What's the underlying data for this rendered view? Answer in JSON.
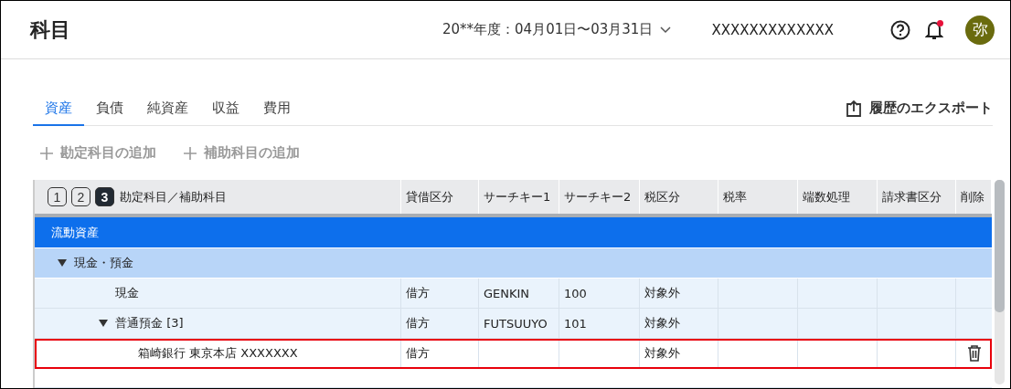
{
  "header": {
    "title": "科目",
    "period": "20**年度：04月01日〜03月31日",
    "company": "XXXXXXXXXXXXX",
    "avatar": "弥",
    "notification": true
  },
  "tabs": [
    {
      "label": "資産",
      "selected": true
    },
    {
      "label": "負債",
      "selected": false
    },
    {
      "label": "純資産",
      "selected": false
    },
    {
      "label": "収益",
      "selected": false
    },
    {
      "label": "費用",
      "selected": false
    }
  ],
  "export_button": "履歴のエクスポート",
  "actions": [
    {
      "label": "勘定科目の追加",
      "disabled": true
    },
    {
      "label": "補助科目の追加",
      "disabled": true
    }
  ],
  "table": {
    "levels": [
      {
        "label": "1",
        "selected": false
      },
      {
        "label": "2",
        "selected": false
      },
      {
        "label": "3",
        "selected": true
      }
    ],
    "columns": [
      "勘定科目／補助科目",
      "貸借区分",
      "サーチキー1",
      "サーチキー2",
      "税区分",
      "税率",
      "端数処理",
      "請求書区分",
      "削除"
    ],
    "rows": [
      {
        "kind": "section",
        "name": "流動資産",
        "selected": false,
        "children": [
          {
            "kind": "category",
            "name": "現金・預金",
            "expanded": true,
            "selected": false,
            "children": [
              {
                "kind": "account",
                "name": "現金",
                "cells": [
                  "借方",
                  "GENKIN",
                  "100",
                  "対象外",
                  "",
                  "",
                  ""
                ],
                "deletable": false,
                "selected": false
              },
              {
                "kind": "account",
                "name": "普通預金 [3]",
                "expanded": true,
                "cells": [
                  "借方",
                  "FUTSUUYO",
                  "101",
                  "対象外",
                  "",
                  "",
                  ""
                ],
                "deletable": false,
                "selected": false,
                "children": [
                  {
                    "kind": "sub",
                    "name": "箱崎銀行 東京本店  XXXXXXX",
                    "cells": [
                      "借方",
                      "",
                      "",
                      "対象外",
                      "",
                      "",
                      ""
                    ],
                    "deletable": true,
                    "selected": true
                  }
                ]
              }
            ]
          }
        ]
      }
    ]
  }
}
